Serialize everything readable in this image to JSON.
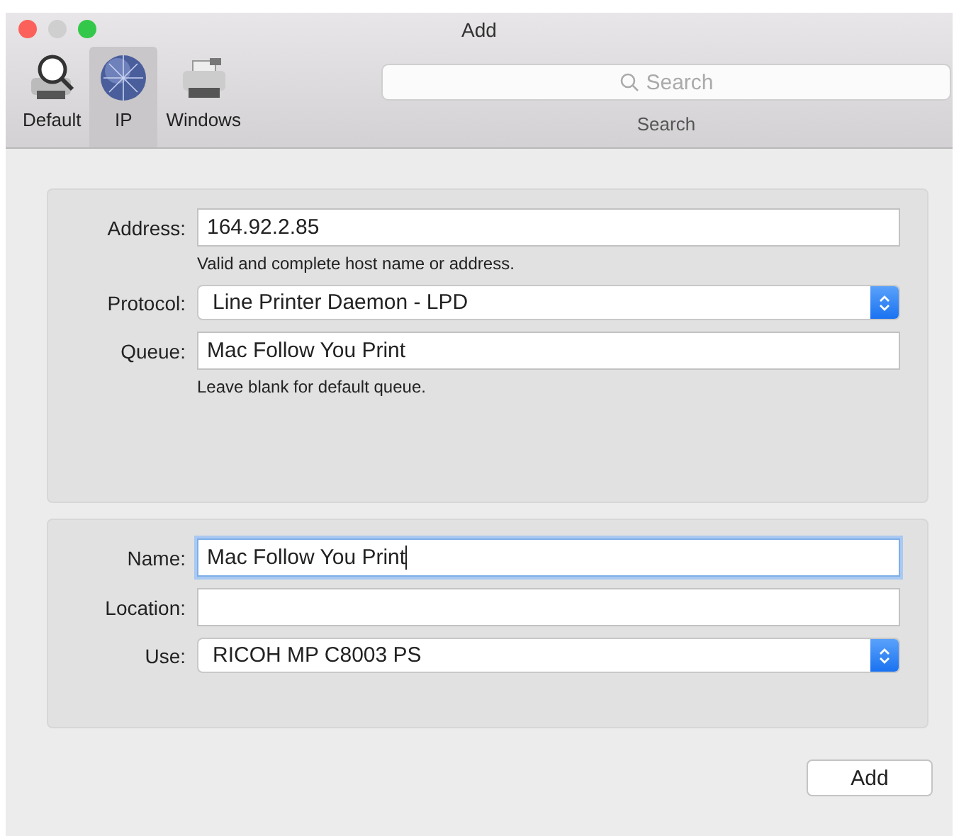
{
  "window": {
    "title": "Add"
  },
  "toolbar": {
    "items": [
      {
        "label": "Default",
        "kind": "default",
        "selected": false
      },
      {
        "label": "IP",
        "kind": "ip",
        "selected": true
      },
      {
        "label": "Windows",
        "kind": "windows",
        "selected": false
      }
    ],
    "search": {
      "placeholder": "Search",
      "label": "Search"
    }
  },
  "panels": [
    {
      "rows": [
        {
          "label": "Address:",
          "kind": "text",
          "value": "164.92.2.85",
          "focused": false,
          "hint": "Valid and complete host name or address."
        },
        {
          "label": "Protocol:",
          "kind": "popup",
          "value": "Line Printer Daemon - LPD"
        },
        {
          "label": "Queue:",
          "kind": "text",
          "value": "Mac Follow You Print",
          "focused": false,
          "hint": "Leave blank for default queue."
        }
      ]
    },
    {
      "rows": [
        {
          "label": "Name:",
          "kind": "text",
          "value": "Mac Follow You Print",
          "focused": true
        },
        {
          "label": "Location:",
          "kind": "text",
          "focused": false
        },
        {
          "label": "Use:",
          "kind": "popup",
          "value": "RICOH MP C8003 PS"
        }
      ]
    }
  ],
  "buttons": [
    {
      "label": "Add"
    }
  ]
}
